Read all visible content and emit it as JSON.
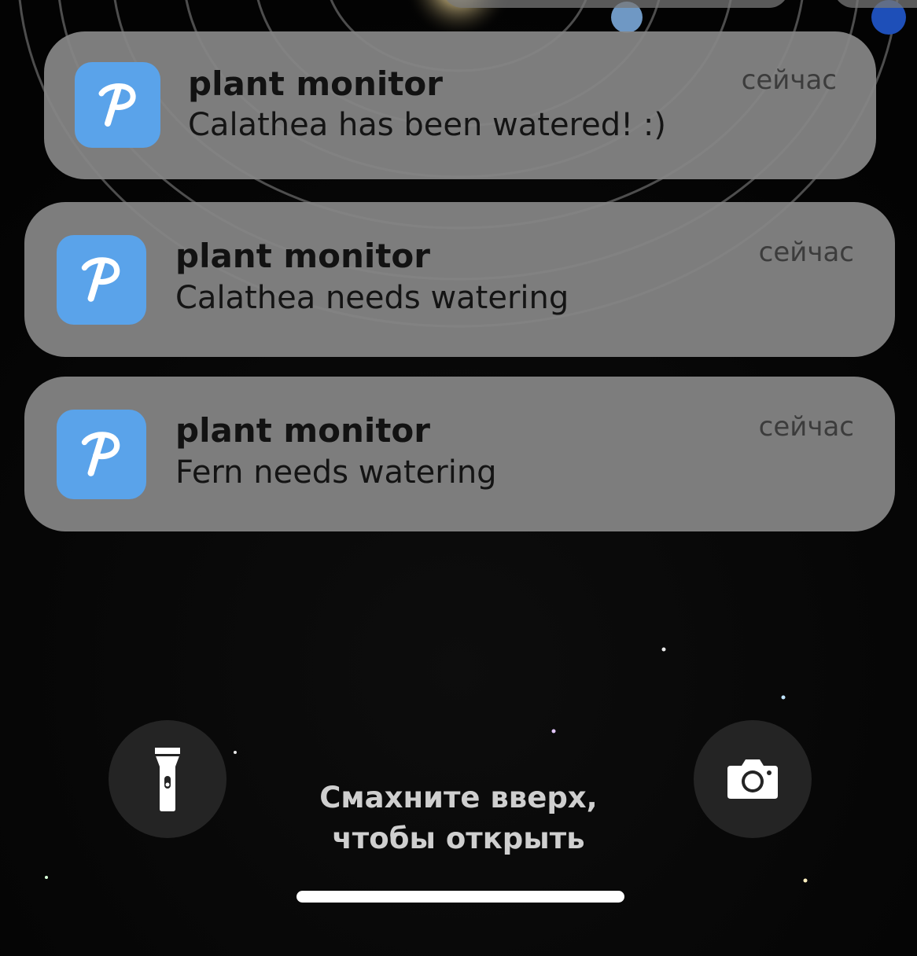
{
  "notifications": [
    {
      "app_name": "plant monitor",
      "icon_letter": "P",
      "message": "Calathea has been watered! :)",
      "time": "сейчас"
    },
    {
      "app_name": "plant monitor",
      "icon_letter": "P",
      "message": "Calathea needs watering",
      "time": "сейчас"
    },
    {
      "app_name": "plant monitor",
      "icon_letter": "P",
      "message": "Fern needs watering",
      "time": "сейчас"
    }
  ],
  "lock_screen": {
    "swipe_hint_line1": "Смахните вверх,",
    "swipe_hint_line2": "чтобы открыть",
    "flashlight_icon": "flashlight-icon",
    "camera_icon": "camera-icon"
  },
  "colors": {
    "app_icon": "#5aa3ea",
    "notification_bg": "#878787",
    "background": "#050505"
  }
}
